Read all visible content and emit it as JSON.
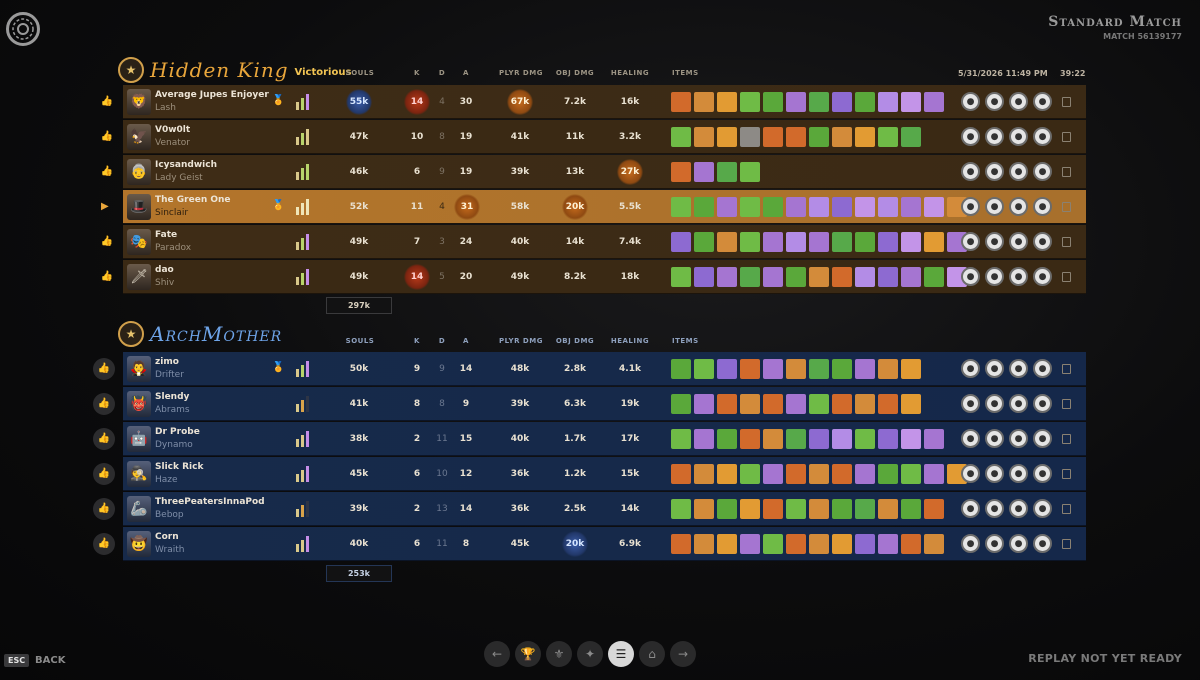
{
  "match": {
    "title": "Standard Match",
    "id": "MATCH 56139177",
    "date": "5/31/2026 11:49 PM",
    "duration": "39:22"
  },
  "columns": {
    "souls": "SOULS",
    "k": "K",
    "d": "D",
    "a": "A",
    "plyr": "PLYR DMG",
    "obj": "OBJ DMG",
    "heal": "HEALING",
    "items": "ITEMS"
  },
  "teams": [
    {
      "name": "Hidden King",
      "status": "Victorious",
      "total_souls": "297k",
      "players": [
        {
          "name": "Average Jupes Enjoyer",
          "hero": "Lash",
          "souls": "55k",
          "k": "14",
          "d": "4",
          "a": "30",
          "plyr": "67k",
          "obj": "7.2k",
          "heal": "16k"
        },
        {
          "name": "V0w0lt",
          "hero": "Venator",
          "souls": "47k",
          "k": "10",
          "d": "8",
          "a": "19",
          "plyr": "41k",
          "obj": "11k",
          "heal": "3.2k"
        },
        {
          "name": "Icysandwich",
          "hero": "Lady Geist",
          "souls": "46k",
          "k": "6",
          "d": "9",
          "a": "19",
          "plyr": "39k",
          "obj": "13k",
          "heal": "27k"
        },
        {
          "name": "The Green One",
          "hero": "Sinclair",
          "souls": "52k",
          "k": "11",
          "d": "4",
          "a": "31",
          "plyr": "58k",
          "obj": "20k",
          "heal": "5.5k"
        },
        {
          "name": "Fate",
          "hero": "Paradox",
          "souls": "49k",
          "k": "7",
          "d": "3",
          "a": "24",
          "plyr": "40k",
          "obj": "14k",
          "heal": "7.4k"
        },
        {
          "name": "dao",
          "hero": "Shiv",
          "souls": "49k",
          "k": "14",
          "d": "5",
          "a": "20",
          "plyr": "49k",
          "obj": "8.2k",
          "heal": "18k"
        }
      ]
    },
    {
      "name": "ArchMother",
      "total_souls": "253k",
      "players": [
        {
          "name": "zimo",
          "hero": "Drifter",
          "souls": "50k",
          "k": "9",
          "d": "9",
          "a": "14",
          "plyr": "48k",
          "obj": "2.8k",
          "heal": "4.1k"
        },
        {
          "name": "Slendy",
          "hero": "Abrams",
          "souls": "41k",
          "k": "8",
          "d": "8",
          "a": "9",
          "plyr": "39k",
          "obj": "6.3k",
          "heal": "19k"
        },
        {
          "name": "Dr Probe",
          "hero": "Dynamo",
          "souls": "38k",
          "k": "2",
          "d": "11",
          "a": "15",
          "plyr": "40k",
          "obj": "1.7k",
          "heal": "17k"
        },
        {
          "name": "Slick Rick",
          "hero": "Haze",
          "souls": "45k",
          "k": "6",
          "d": "10",
          "a": "12",
          "plyr": "36k",
          "obj": "1.2k",
          "heal": "15k"
        },
        {
          "name": "ThreePeatersInnaPod",
          "hero": "Bebop",
          "souls": "39k",
          "k": "2",
          "d": "13",
          "a": "14",
          "plyr": "36k",
          "obj": "2.5k",
          "heal": "14k"
        },
        {
          "name": "Corn",
          "hero": "Wraith",
          "souls": "40k",
          "k": "6",
          "d": "11",
          "a": "8",
          "plyr": "45k",
          "obj": "20k",
          "heal": "6.9k"
        }
      ]
    }
  ],
  "footer": {
    "esc": "ESC",
    "back": "BACK",
    "replay": "REPLAY NOT YET READY"
  },
  "colors": {
    "amber_row": "#3a2914",
    "highlight_row": "#b3752b",
    "blue_row": "#172a4a"
  }
}
